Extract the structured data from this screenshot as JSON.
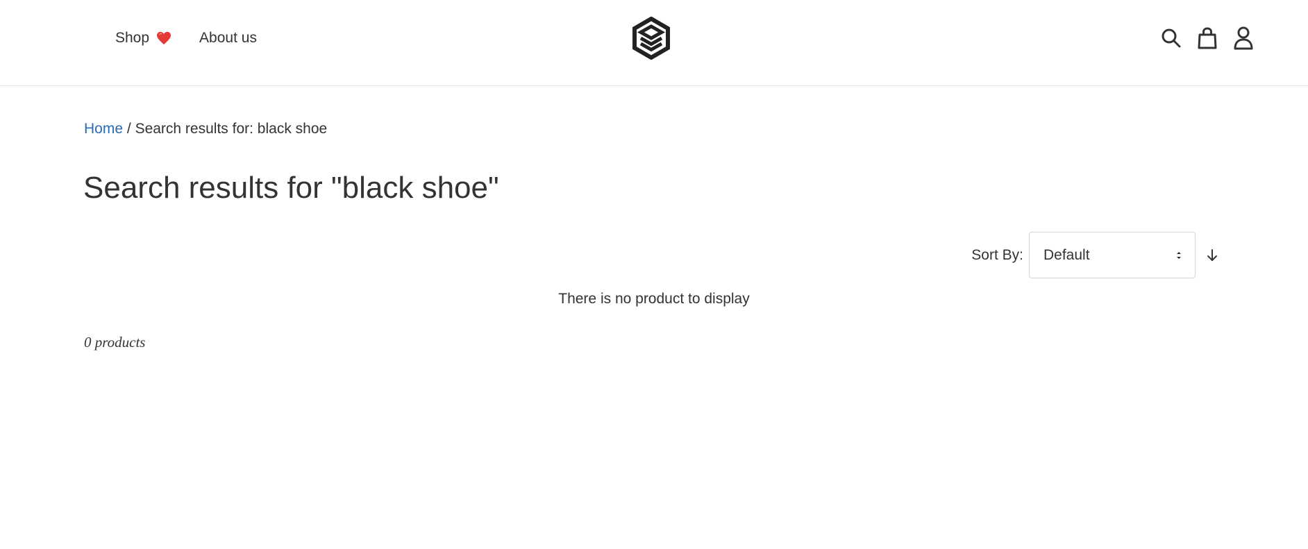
{
  "header": {
    "nav": [
      {
        "label": "Shop"
      },
      {
        "label": "About us"
      }
    ],
    "icons": [
      "search-icon",
      "cart-icon",
      "user-icon"
    ],
    "heart_color": "#e53935"
  },
  "breadcrumb": {
    "home": "Home",
    "separator": "/",
    "current": "Search results for: black shoe"
  },
  "page_title": "Search results for \"black shoe\"",
  "sort": {
    "label": "Sort By:",
    "selected": "Default"
  },
  "empty_message": "There is no product to display",
  "product_count": "0 products",
  "colors": {
    "link": "#2a6ab8",
    "text": "#333333"
  }
}
